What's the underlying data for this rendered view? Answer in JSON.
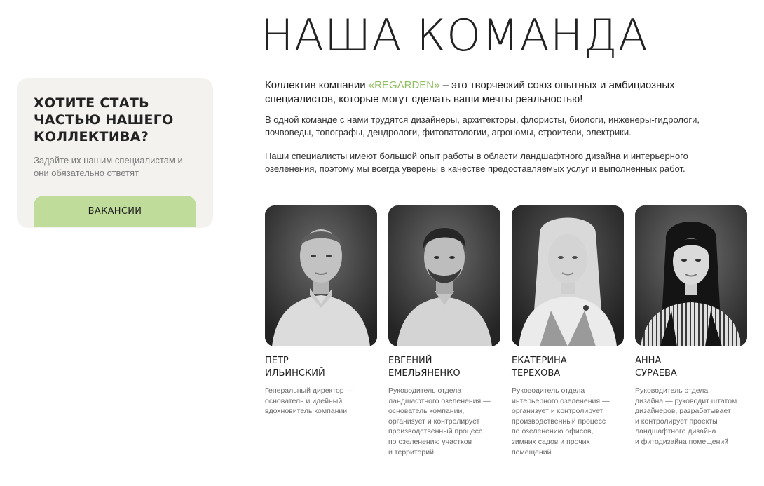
{
  "page": {
    "title": "НАША КОМАНДА"
  },
  "join_card": {
    "heading": "ХОТИТЕ СТАТЬ ЧАСТЬЮ НАШЕГО КОЛЛЕКТИВА?",
    "text": "Задайте их нашим специалистам и они обязательно ответят",
    "button_label": "ВАКАНСИИ"
  },
  "intro": {
    "lead_before": "Коллектив компании ",
    "brand": "«REGARDEN»",
    "lead_after": " – это творческий союз опытных и амбициозных специалистов, которые могут сделать ваши мечты реальностью!",
    "paragraph_1": "В одной команде с нами трудятся дизайнеры, архитекторы, флористы, биологи, инженеры-гидрологи, почвоведы, топографы, дендрологи, фитопатологии, агрономы, строители, электрики.",
    "paragraph_2": "Наши специалисты имеют большой опыт работы в области ландшафтного дизайна и интерьерного озеленения, поэтому мы всегда уверены в качестве предоставляемых услуг и выполненных работ."
  },
  "team": [
    {
      "first_name": "ПЕТР",
      "last_name": "ИЛЬИНСКИЙ",
      "role": "Генеральный директор —\nоснователь и идейный\nвдохновитель компании"
    },
    {
      "first_name": "ЕВГЕНИЙ",
      "last_name": "ЕМЕЛЬЯНЕНКО",
      "role": "Руководитель отдела\nландшафтного озеленения —\nоснователь компании,\nорганизует и контролирует\nпроизводственный процесс\nпо озеленению участков\nи территорий"
    },
    {
      "first_name": "ЕКАТЕРИНА",
      "last_name": "ТЕРЕХОВА",
      "role": "Руководитель отдела\nинтерьерного озеленения —\nорганизует и контролирует\nпроизводственный процесс\nпо озеленению офисов,\nзимних садов и прочих\nпомещений"
    },
    {
      "first_name": "АННА",
      "last_name": "СУРАЕВА",
      "role": "Руководитель отдела\nдизайна — руководит штатом\nдизайнеров, разрабатывает\nи контролирует проекты\nландшафтного дизайна\nи фитодизайна помещений"
    }
  ],
  "colors": {
    "accent_green": "#bfdc9a",
    "brand_green": "#8fbf5f",
    "card_bg": "#f4f2ee"
  }
}
